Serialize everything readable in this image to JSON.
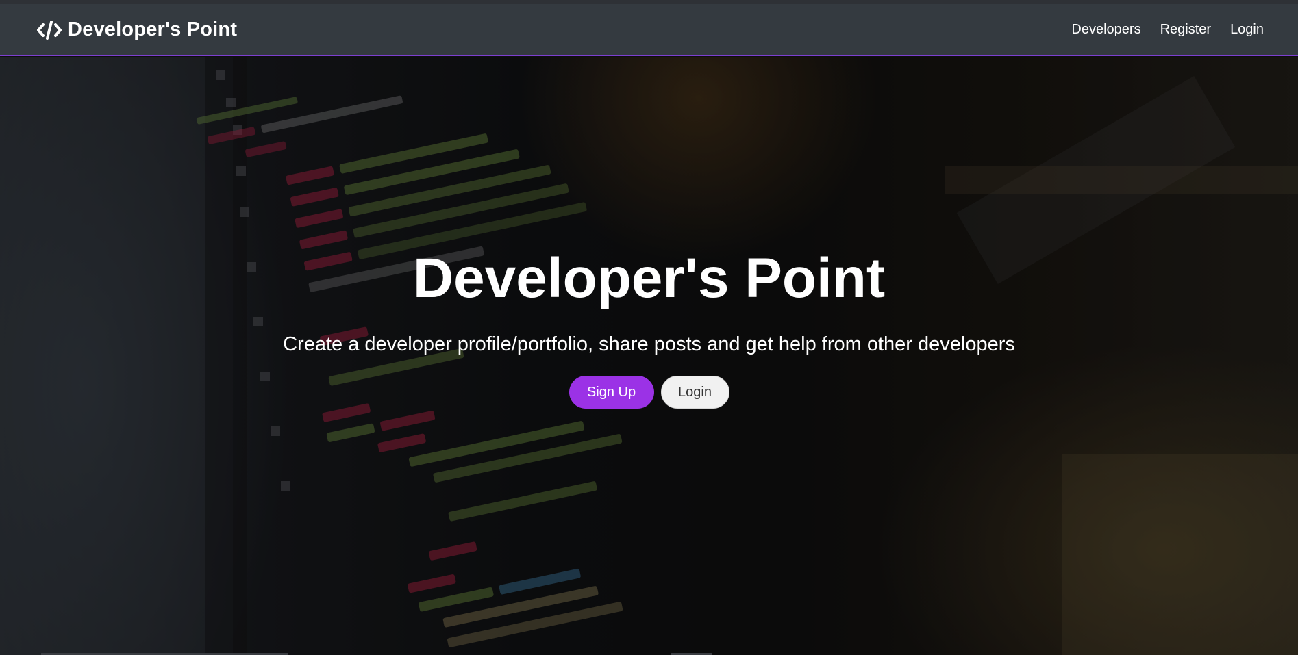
{
  "navbar": {
    "brand": {
      "icon": "code-icon",
      "text": "Developer's Point"
    },
    "links": [
      {
        "label": "Developers"
      },
      {
        "label": "Register"
      },
      {
        "label": "Login"
      }
    ]
  },
  "hero": {
    "title": "Developer's Point",
    "lead": "Create a developer profile/portfolio, share posts and get help from other developers",
    "buttons": {
      "signup": "Sign Up",
      "login": "Login"
    }
  },
  "colors": {
    "navbar_bg": "#343a40",
    "navbar_border": "#7d3fd0",
    "primary": "#9b32e6",
    "light": "#f1f1f1"
  }
}
